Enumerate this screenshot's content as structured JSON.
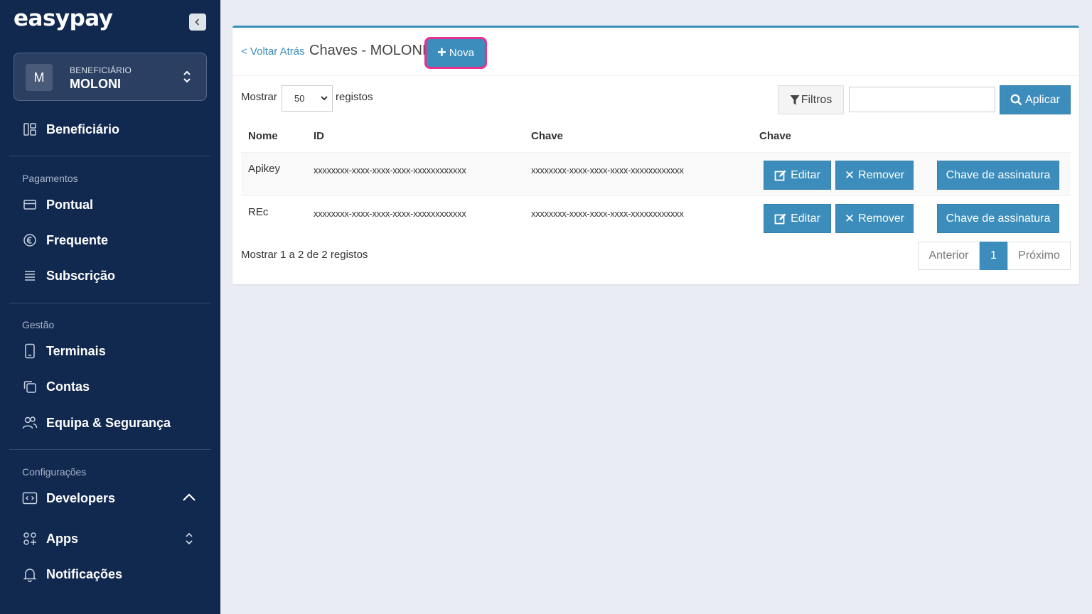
{
  "sidebar": {
    "brand": "easypay",
    "beneficiary": {
      "label": "BENEFICIÁRIO",
      "name": "MOLONI",
      "avatar": "M"
    },
    "top_item": "Beneficiário",
    "sections": {
      "payments": {
        "label": "Pagamentos",
        "items": [
          "Pontual",
          "Frequente",
          "Subscrição"
        ]
      },
      "management": {
        "label": "Gestão",
        "items": [
          "Terminais",
          "Contas",
          "Equipa & Segurança"
        ]
      },
      "settings": {
        "label": "Configurações",
        "items": [
          "Developers",
          "Apps",
          "Notificações"
        ]
      }
    }
  },
  "header": {
    "back_link": "< Voltar Atrás",
    "title": "Chaves - MOLONI",
    "new_button": "Nova"
  },
  "controls": {
    "show_label": "Mostrar",
    "page_size": "50",
    "records_label": "registos",
    "filters_button": "Filtros",
    "search_value": "",
    "apply_button": "Aplicar"
  },
  "table": {
    "columns": [
      "Nome",
      "ID",
      "Chave",
      "Chave"
    ],
    "rows": [
      {
        "name": "Apikey",
        "id": "xxxxxxxx-xxxx-xxxx-xxxx-xxxxxxxxxxxx",
        "key": "xxxxxxxx-xxxx-xxxx-xxxx-xxxxxxxxxxxx"
      },
      {
        "name": "REc",
        "id": "xxxxxxxx-xxxx-xxxx-xxxx-xxxxxxxxxxxx",
        "key": "xxxxxxxx-xxxx-xxxx-xxxx-xxxxxxxxxxxx"
      }
    ],
    "actions": {
      "edit": "Editar",
      "remove": "Remover",
      "signature": "Chave de assinatura"
    }
  },
  "footer": {
    "info": "Mostrar 1 a 2 de 2 registos",
    "pagination": {
      "previous": "Anterior",
      "current": "1",
      "next": "Próximo"
    }
  },
  "colors": {
    "sidebar_bg": "#11284f",
    "accent": "#3c8dbc",
    "highlight": "#e8308f"
  }
}
